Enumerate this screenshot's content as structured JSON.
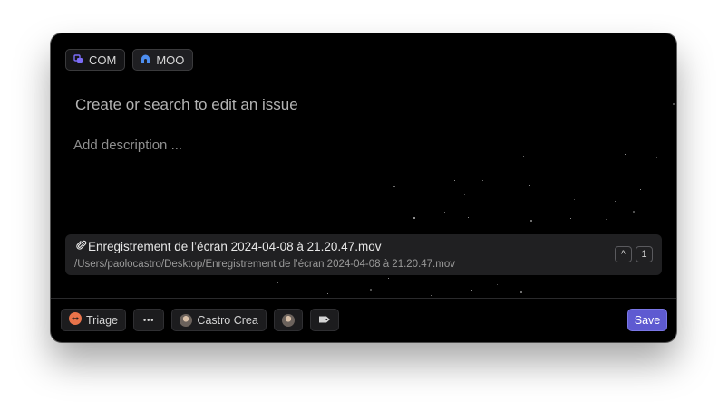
{
  "chips": [
    {
      "label": "COM",
      "icon": "team-icon"
    },
    {
      "label": "MOO",
      "icon": "project-icon"
    }
  ],
  "editor": {
    "title_placeholder": "Create or search to edit an issue",
    "description_placeholder": "Add description ..."
  },
  "attachment": {
    "filename": "Enregistrement de l’écran 2024-04-08 à 21.20.47.mov",
    "path": "/Users/paolocastro/Desktop/Enregistrement de l’écran 2024-04-08 à 21.20.47.mov",
    "count": "1",
    "prev_key": "^"
  },
  "footer": {
    "status_label": "Triage",
    "more_label": "•••",
    "assignee_label": "Castro Crea",
    "save_label": "Save"
  },
  "colors": {
    "accent": "#5e5ad1",
    "triage": "#e8734a",
    "team_icon": "#7b6cf6",
    "project_icon": "#4d8ef0"
  }
}
